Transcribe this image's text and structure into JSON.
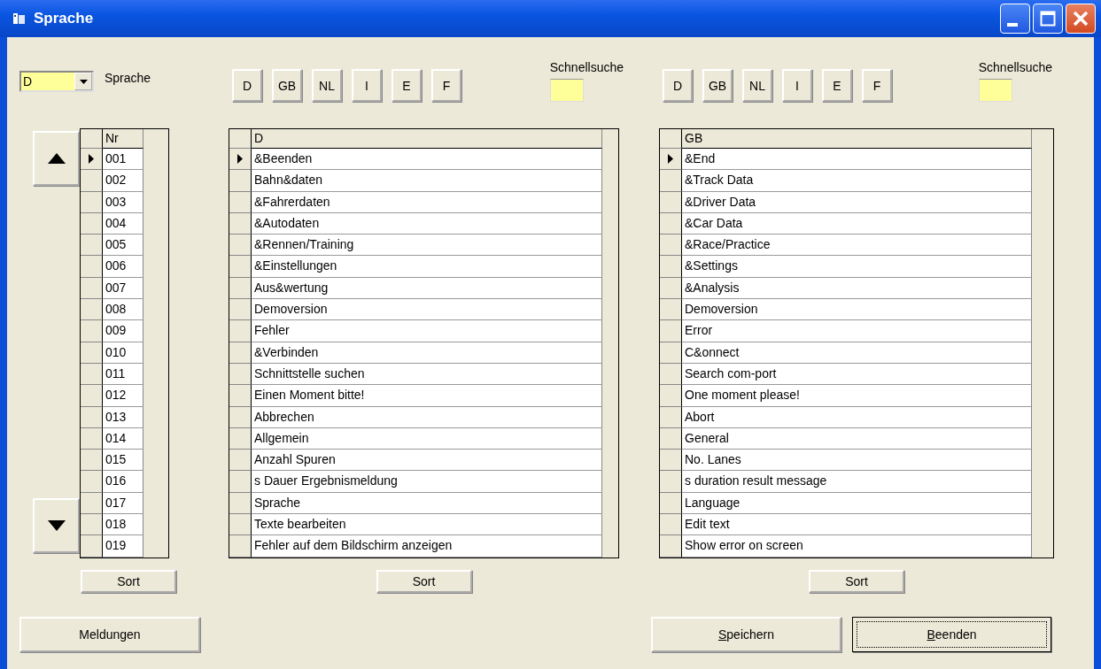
{
  "window": {
    "title": "Sprache"
  },
  "language_select": {
    "value": "D",
    "label": "Sprache"
  },
  "number_table": {
    "column": "Nr",
    "rows": [
      {
        "text": "001",
        "selected": true
      },
      {
        "text": "002",
        "selected": false
      },
      {
        "text": "003",
        "selected": false
      },
      {
        "text": "004",
        "selected": false
      },
      {
        "text": "005",
        "selected": false
      },
      {
        "text": "006",
        "selected": false
      },
      {
        "text": "007",
        "selected": false
      },
      {
        "text": "008",
        "selected": false
      },
      {
        "text": "009",
        "selected": false
      },
      {
        "text": "010",
        "selected": false
      },
      {
        "text": "011",
        "selected": false
      },
      {
        "text": "012",
        "selected": false
      },
      {
        "text": "013",
        "selected": false
      },
      {
        "text": "014",
        "selected": false
      },
      {
        "text": "015",
        "selected": false
      },
      {
        "text": "016",
        "selected": false
      },
      {
        "text": "017",
        "selected": false
      },
      {
        "text": "018",
        "selected": false
      },
      {
        "text": "019",
        "selected": false
      }
    ],
    "sort_button": "Sort"
  },
  "panels": [
    {
      "language_buttons": [
        "D",
        "GB",
        "NL",
        "I",
        "E",
        "F"
      ],
      "search_label": "Schnellsuche",
      "table": {
        "column": "D",
        "rows": [
          {
            "text": "&Beenden",
            "selected": true
          },
          {
            "text": "Bahn&daten",
            "selected": false
          },
          {
            "text": "&Fahrerdaten",
            "selected": false
          },
          {
            "text": "&Autodaten",
            "selected": false
          },
          {
            "text": "&Rennen/Training",
            "selected": false
          },
          {
            "text": "&Einstellungen",
            "selected": false
          },
          {
            "text": "Aus&wertung",
            "selected": false
          },
          {
            "text": "Demoversion",
            "selected": false
          },
          {
            "text": "Fehler",
            "selected": false
          },
          {
            "text": "&Verbinden",
            "selected": false
          },
          {
            "text": "Schnittstelle suchen",
            "selected": false
          },
          {
            "text": "Einen Moment bitte!",
            "selected": false
          },
          {
            "text": "Abbrechen",
            "selected": false
          },
          {
            "text": "Allgemein",
            "selected": false
          },
          {
            "text": "Anzahl Spuren",
            "selected": false
          },
          {
            "text": "s Dauer Ergebnismeldung",
            "selected": false
          },
          {
            "text": "Sprache",
            "selected": false
          },
          {
            "text": "Texte bearbeiten",
            "selected": false
          },
          {
            "text": "Fehler auf dem Bildschirm anzeigen",
            "selected": false
          }
        ]
      },
      "sort_button": "Sort"
    },
    {
      "language_buttons": [
        "D",
        "GB",
        "NL",
        "I",
        "E",
        "F"
      ],
      "search_label": "Schnellsuche",
      "table": {
        "column": "GB",
        "rows": [
          {
            "text": "&End",
            "selected": true
          },
          {
            "text": "&Track Data",
            "selected": false
          },
          {
            "text": "&Driver Data",
            "selected": false
          },
          {
            "text": "&Car Data",
            "selected": false
          },
          {
            "text": "&Race/Practice",
            "selected": false
          },
          {
            "text": "&Settings",
            "selected": false
          },
          {
            "text": "&Analysis",
            "selected": false
          },
          {
            "text": "Demoversion",
            "selected": false
          },
          {
            "text": "Error",
            "selected": false
          },
          {
            "text": "C&onnect",
            "selected": false
          },
          {
            "text": "Search com-port",
            "selected": false
          },
          {
            "text": "One moment please!",
            "selected": false
          },
          {
            "text": "Abort",
            "selected": false
          },
          {
            "text": "General",
            "selected": false
          },
          {
            "text": "No. Lanes",
            "selected": false
          },
          {
            "text": "s duration result message",
            "selected": false
          },
          {
            "text": "Language",
            "selected": false
          },
          {
            "text": "Edit text",
            "selected": false
          },
          {
            "text": "Show error on screen",
            "selected": false
          }
        ]
      },
      "sort_button": "Sort"
    }
  ],
  "buttons": [
    {
      "label": "Meldungen",
      "mnemonic": false,
      "default": false
    },
    {
      "label": "Speichern",
      "mnemonic": true,
      "default": false
    },
    {
      "label": "Beenden",
      "mnemonic": true,
      "default": true
    }
  ]
}
